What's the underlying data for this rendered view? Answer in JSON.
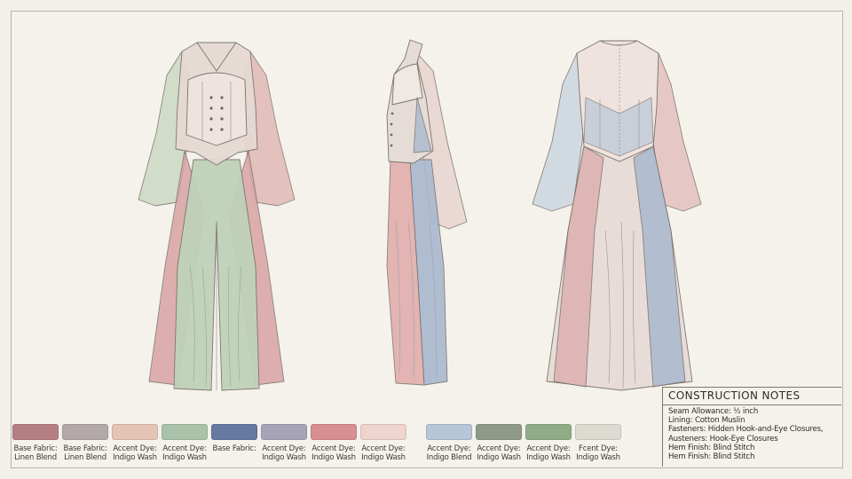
{
  "swatches": [
    {
      "line1": "Base Fabric:",
      "line2": "Linen Blend",
      "color": "#b57f84"
    },
    {
      "line1": "Base Fabric:",
      "line2": "Linen Blend",
      "color": "#b3a9ab"
    },
    {
      "line1": "Accent Dye:",
      "line2": "Indigo Wash",
      "color": "#e6c4b5"
    },
    {
      "line1": "Accent Dye:",
      "line2": "Indigo Wash",
      "color": "#a9c2a8"
    },
    {
      "line1": "Base Fabric:",
      "line2": "",
      "color": "#66799f"
    },
    {
      "line1": "Accent Dye:",
      "line2": "Indigo Wash",
      "color": "#a7a3b8"
    },
    {
      "line1": "Accent Dye:",
      "line2": "Indigo Wash",
      "color": "#d98f8f"
    },
    {
      "line1": "Accent Dye:",
      "line2": "Indigo Wash",
      "color": "#efd3cd"
    },
    {
      "line1": "Accent Dye:",
      "line2": "Indigo Blend",
      "color": "#b6c5d7"
    },
    {
      "line1": "Accent Dye:",
      "line2": "Indigo Wash",
      "color": "#8e9988"
    },
    {
      "line1": "Accent Dye:",
      "line2": "Indigo Wash",
      "color": "#8fae87"
    },
    {
      "line1": "Fcent Dye:",
      "line2": "Indigo Wash",
      "color": "#dcdad1"
    }
  ],
  "notes": {
    "title": "CONSTRUCTION NOTES",
    "lines": [
      "Seam Allowance: ½ inch",
      "Lining: Cotton Muslin",
      "Fasteners: Hidden Hook-and-Eye Closures,",
      "Austeners: Hook-Eye Closures",
      "Hem Finish: Blind Stitch",
      "Hem Finish: Blind Stitch"
    ]
  },
  "palette": {
    "rose": "#d8a3a3",
    "sage": "#b9cfb3",
    "blush": "#ead1cb",
    "blue": "#9eb0cc",
    "ink": "#6e6660"
  }
}
